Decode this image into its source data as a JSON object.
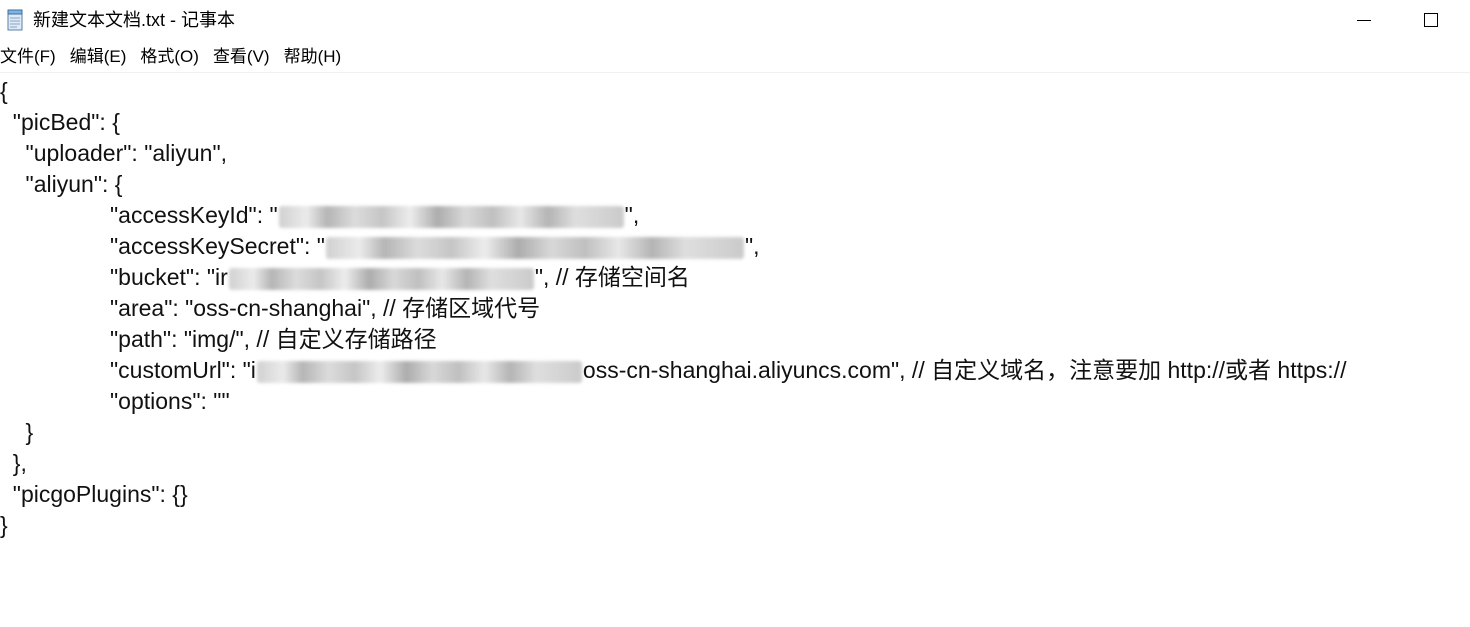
{
  "window": {
    "title": "新建文本文档.txt - 记事本"
  },
  "menu": {
    "file": "文件(F)",
    "edit": "编辑(E)",
    "format": "格式(O)",
    "view": "查看(V)",
    "help": "帮助(H)"
  },
  "lines": {
    "l1": "{",
    "l2": "  \"picBed\": {",
    "l3": "    \"uploader\": \"aliyun\",",
    "l4": "    \"aliyun\": {",
    "l5a": "\"accessKeyId\": \"",
    "l5b": "\",",
    "l6a": "\"accessKeySecret\": \"",
    "l6b": "\",",
    "l7a": "\"bucket\": \"ir",
    "l7b": "\", // 存储空间名",
    "l8": "\"area\": \"oss-cn-shanghai\", // 存储区域代号",
    "l9": "\"path\": \"img/\", // 自定义存储路径",
    "l10a": "\"customUrl\": \"i",
    "l10b": "oss-cn-shanghai.aliyuncs.com\", // 自定义域名，注意要加 http://或者 https://",
    "l11": "\"options\": \"\"",
    "l12": "    }",
    "l13": "  },",
    "l14": "  \"picgoPlugins\": {}",
    "l15": "}"
  }
}
